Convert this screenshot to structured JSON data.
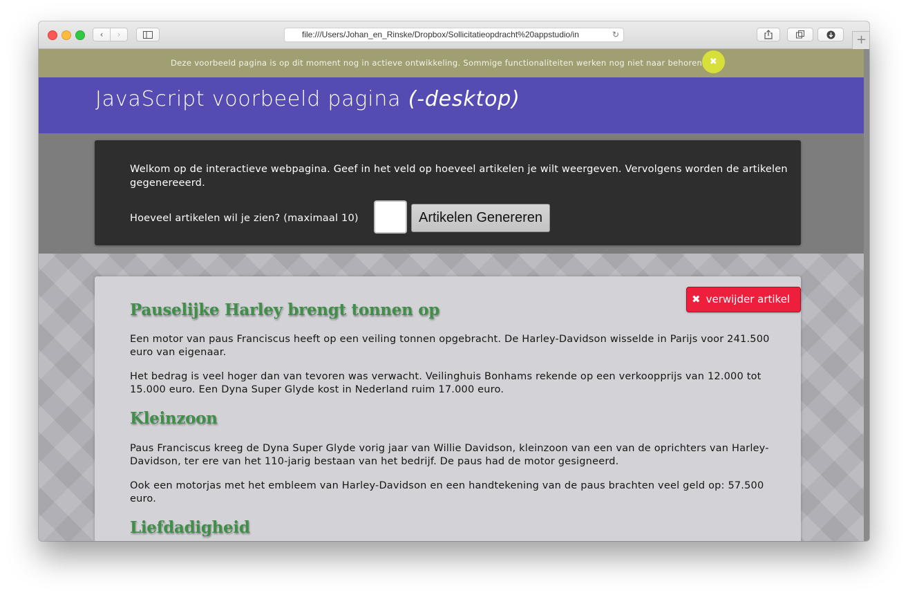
{
  "browser": {
    "url": "file:///Users/Johan_en_Rinske/Dropbox/Sollicitatieopdracht%20appstudio/in",
    "back_icon": "‹",
    "forward_icon": "›",
    "reload_icon": "↻",
    "newtab_icon": "+"
  },
  "notice": {
    "text": "Deze voorbeeld pagina is op dit moment nog in actieve ontwikkeling. Sommige functionaliteiten werken nog niet naar behoren.",
    "close_icon": "✖"
  },
  "header": {
    "title_main": "JavaScript voorbeeld pagina ",
    "title_suffix": "(-desktop)"
  },
  "intro": {
    "text": "Welkom op de interactieve webpagina. Geef in het veld op hoeveel artikelen je wilt weergeven. Vervolgens worden de artikelen gegenereeerd.",
    "form_label": "Hoeveel artikelen wil je zien? (maximaal 10)",
    "input_value": "",
    "button_label": "Artikelen Genereren"
  },
  "article": {
    "delete_icon": "✖",
    "delete_label": "verwijder artikel",
    "heading1": "Pauselijke Harley brengt tonnen op",
    "para1": "Een motor van paus Franciscus heeft op een veiling tonnen opgebracht. De Harley-Davidson wisselde in Parijs voor 241.500 euro van eigenaar.",
    "para2": "Het bedrag is veel hoger dan van tevoren was verwacht. Veilinghuis Bonhams rekende op een verkoopprijs van 12.000 tot 15.000 euro. Een Dyna Super Glyde kost in Nederland ruim 17.000 euro.",
    "heading2": "Kleinzoon",
    "para3": "Paus Franciscus kreeg de Dyna Super Glyde vorig jaar van Willie Davidson, kleinzoon van een van de oprichters van Harley-Davidson, ter ere van het 110-jarig bestaan van het bedrijf. De paus had de motor gesigneerd.",
    "para4": "Ook een motorjas met het embleem van Harley-Davidson en een handtekening van de paus brachten veel geld op: 57.500 euro.",
    "heading3": "Liefdadigheid"
  }
}
